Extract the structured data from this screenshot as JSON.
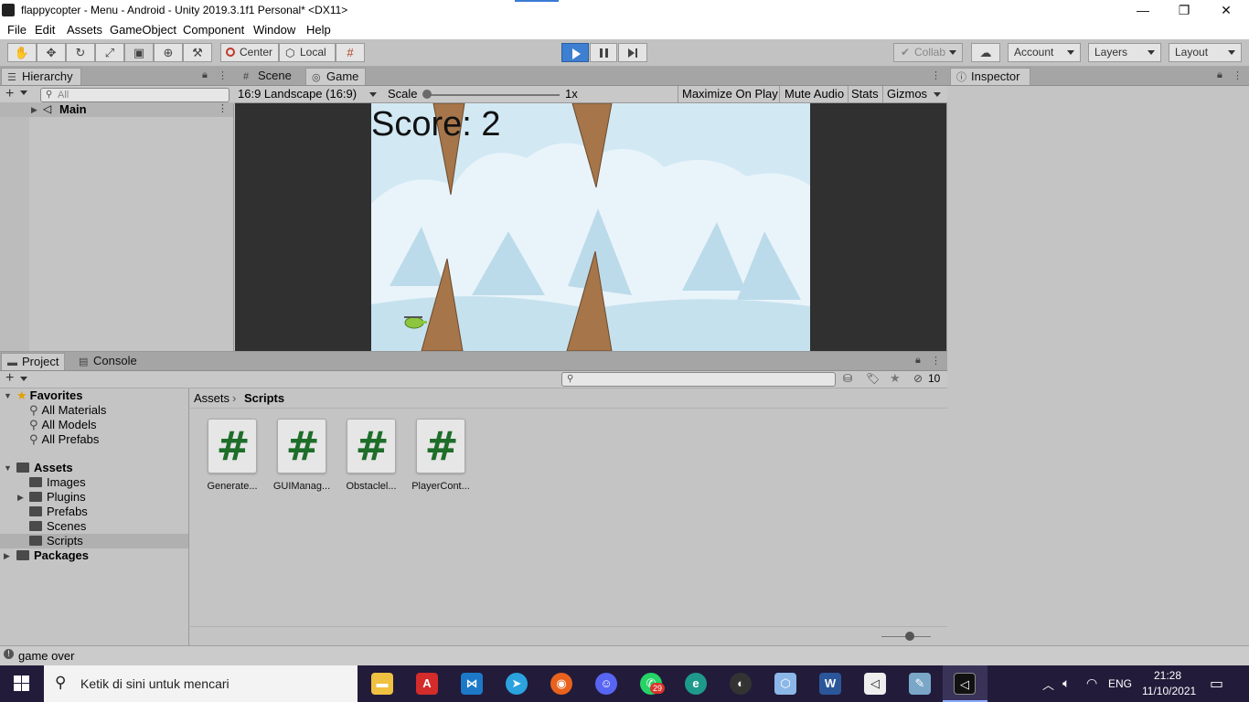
{
  "window": {
    "title": "flappycopter - Menu - Android - Unity 2019.3.1f1 Personal* <DX11>",
    "minimize": "—",
    "restore": "❐",
    "close": "✕"
  },
  "menu": [
    "File",
    "Edit",
    "Assets",
    "GameObject",
    "Component",
    "Window",
    "Help"
  ],
  "toolbar": {
    "pivot": "Center",
    "space": "Local",
    "collab": "Collab",
    "account": "Account",
    "layers": "Layers",
    "layout": "Layout"
  },
  "hierarchy": {
    "tab": "Hierarchy",
    "search_placeholder": "All",
    "scene": "Main"
  },
  "game": {
    "tabs": [
      "Scene",
      "Game"
    ],
    "aspect": "16:9 Landscape (16:9)",
    "scale_label": "Scale",
    "scale_value": "1x",
    "maximize": "Maximize On Play",
    "mute": "Mute Audio",
    "stats": "Stats",
    "gizmos": "Gizmos",
    "score": "Score: 2"
  },
  "inspector": {
    "tab": "Inspector"
  },
  "project": {
    "tabs": [
      "Project",
      "Console"
    ],
    "hidden_count": "10",
    "favorites": {
      "label": "Favorites",
      "items": [
        "All Materials",
        "All Models",
        "All Prefabs"
      ]
    },
    "assets": {
      "label": "Assets",
      "items": [
        "Images",
        "Plugins",
        "Prefabs",
        "Scenes",
        "Scripts"
      ]
    },
    "packages": "Packages",
    "breadcrumb": [
      "Assets",
      "Scripts"
    ],
    "files": [
      "Generate...",
      "GUIManag...",
      "Obstaclel...",
      "PlayerCont..."
    ]
  },
  "status": "game over",
  "taskbar": {
    "search_placeholder": "Ketik di sini untuk mencari",
    "badge": "29",
    "lang": "ENG",
    "time": "21:28",
    "date": "11/10/2021"
  },
  "colors": {
    "play_active": "#3d7fd1",
    "taskbar": "#221b3a",
    "sky": "#cfe8f3",
    "rock": "#a6754a"
  }
}
